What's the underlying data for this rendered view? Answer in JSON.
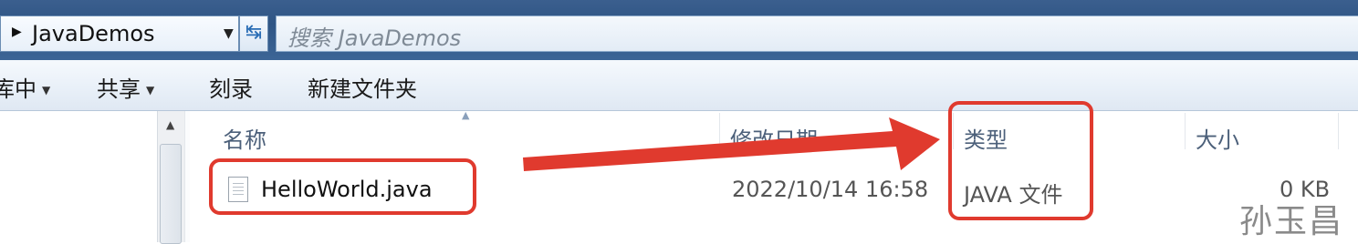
{
  "address_bar": {
    "path_segment": "JavaDemos",
    "chevron_icon": "chevron-right-icon",
    "dropdown_icon": "chevron-down-icon",
    "refresh_icon": "refresh-icon"
  },
  "search": {
    "placeholder": "搜索 JavaDemos"
  },
  "toolbar": {
    "include_in_library_label": "库中",
    "share_label": "共享",
    "burn_label": "刻录",
    "new_folder_label": "新建文件夹"
  },
  "file_list": {
    "columns": {
      "name": "名称",
      "modified": "修改日期",
      "type": "类型",
      "size": "大小"
    },
    "rows": [
      {
        "name": "HelloWorld.java",
        "modified": "2022/10/14 16:58",
        "type": "JAVA 文件",
        "size": "0 KB",
        "icon": "java-file-icon"
      }
    ]
  },
  "annotation": {
    "highlight_color": "#e03a2e",
    "watermark": "孙玉昌"
  },
  "colors": {
    "window_frame": "#2f5585",
    "column_header_text": "#4c607a"
  }
}
